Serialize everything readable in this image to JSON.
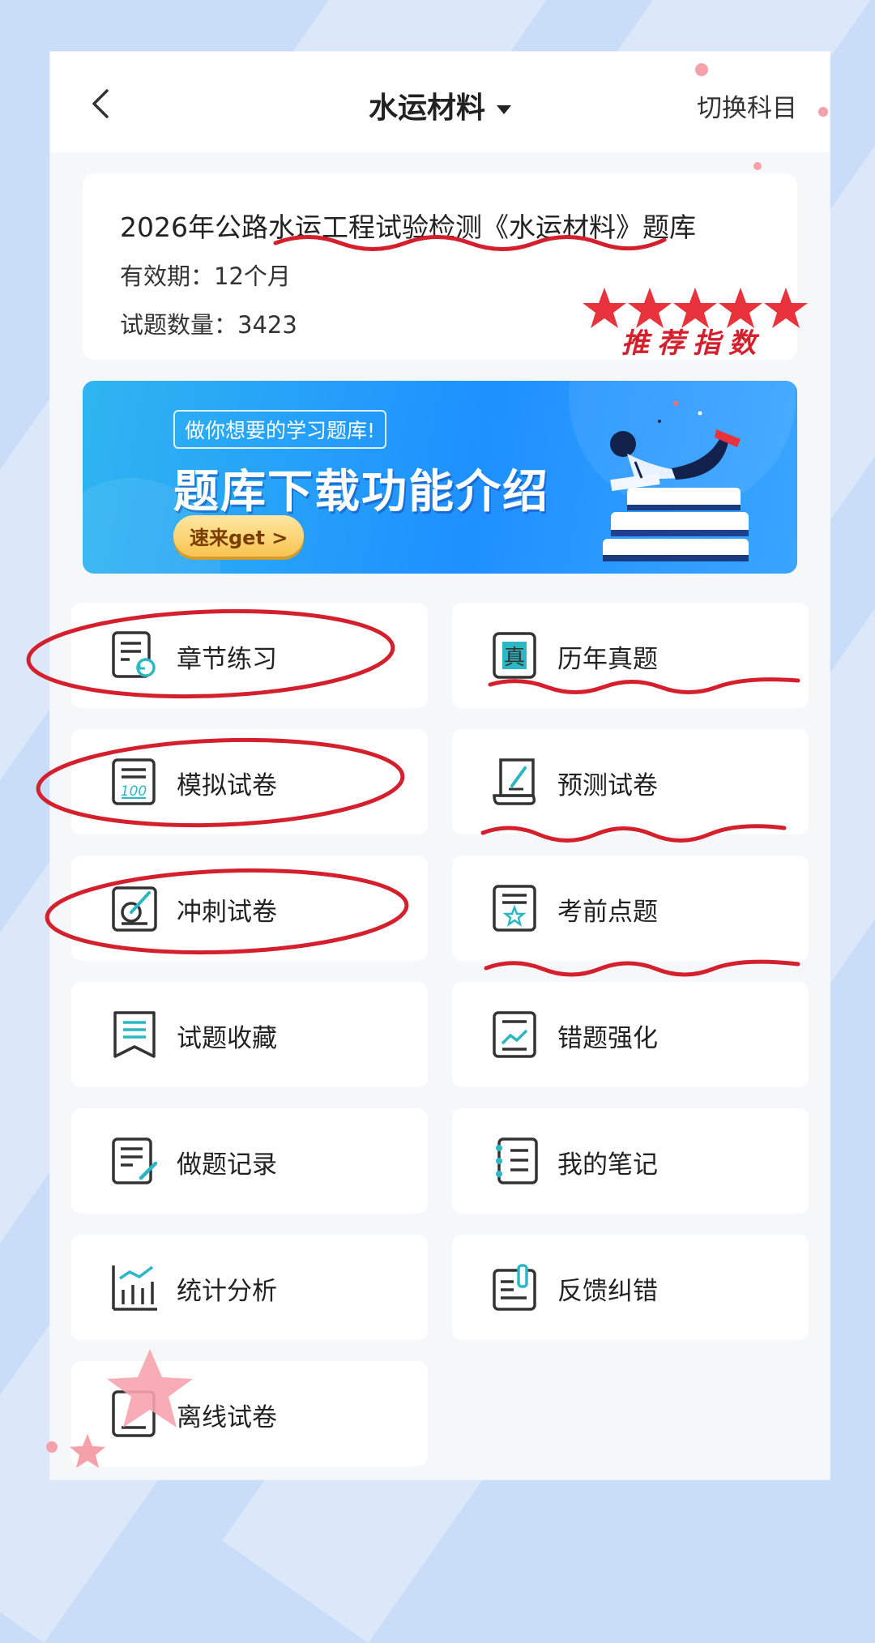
{
  "header": {
    "title": "水运材料",
    "switch_label": "切换科目"
  },
  "info": {
    "title": "2026年公路水运工程试验检测《水运材料》题库",
    "validity": "有效期：12个月",
    "count": "试题数量：3423",
    "stars_text": "推荐指数",
    "rating": 5
  },
  "banner": {
    "tag": "做你想要的学习题库!",
    "headline": "题库下载功能介绍",
    "button": "速来get >"
  },
  "menu": [
    {
      "label": "章节练习",
      "icon": "chapter-practice-icon"
    },
    {
      "label": "历年真题",
      "icon": "past-exam-icon"
    },
    {
      "label": "模拟试卷",
      "icon": "mock-paper-icon"
    },
    {
      "label": "预测试卷",
      "icon": "forecast-paper-icon"
    },
    {
      "label": "冲刺试卷",
      "icon": "sprint-paper-icon"
    },
    {
      "label": "考前点题",
      "icon": "pre-exam-tips-icon"
    },
    {
      "label": "试题收藏",
      "icon": "favorites-icon"
    },
    {
      "label": "错题强化",
      "icon": "mistakes-icon"
    },
    {
      "label": "做题记录",
      "icon": "history-icon"
    },
    {
      "label": "我的笔记",
      "icon": "notes-icon"
    },
    {
      "label": "统计分析",
      "icon": "statistics-icon"
    },
    {
      "label": "反馈纠错",
      "icon": "feedback-icon"
    },
    {
      "label": "离线试卷",
      "icon": "offline-paper-icon"
    }
  ],
  "colors": {
    "accent": "#2bb7c4",
    "annotation": "#d4202c",
    "background": "#c9dcf8"
  }
}
